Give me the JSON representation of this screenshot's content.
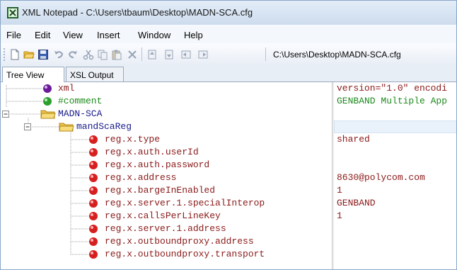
{
  "window": {
    "title": "XML Notepad - C:\\Users\\tbaum\\Desktop\\MADN-SCA.cfg"
  },
  "menu": [
    {
      "label": "File"
    },
    {
      "label": "Edit"
    },
    {
      "label": "View"
    },
    {
      "label": "Insert"
    },
    {
      "label": "Window"
    },
    {
      "label": "Help"
    }
  ],
  "toolbar": {
    "path": "C:\\Users\\Desktop\\MADN-SCA.cfg",
    "buttons": [
      "new-icon",
      "open-icon",
      "save-icon",
      "undo-icon",
      "redo-icon",
      "cut-icon",
      "copy-icon",
      "paste-icon",
      "delete-icon",
      "nudge-up-icon",
      "nudge-down-icon",
      "nudge-left-icon",
      "nudge-right-icon"
    ]
  },
  "tabs": {
    "tree_view": "Tree View",
    "xsl_output": "XSL Output"
  },
  "tree": {
    "xml": {
      "name": "xml",
      "value": "version=\"1.0\" encodi"
    },
    "comment": {
      "name": "#comment",
      "value": "GENBAND Multiple App"
    },
    "root": {
      "name": "MADN-SCA"
    },
    "group": {
      "name": "mandScaReg"
    },
    "attributes": [
      {
        "name": "reg.x.type",
        "value": "shared"
      },
      {
        "name": "reg.x.auth.userId",
        "value": ""
      },
      {
        "name": "reg.x.auth.password",
        "value": ""
      },
      {
        "name": "reg.x.address",
        "value": "8630@polycom.com"
      },
      {
        "name": "reg.x.bargeInEnabled",
        "value": "1"
      },
      {
        "name": "reg.x.server.1.specialInterop",
        "value": "GENBAND"
      },
      {
        "name": "reg.x.callsPerLineKey",
        "value": "1"
      },
      {
        "name": "reg.x.server.1.address",
        "value": ""
      },
      {
        "name": "reg.x.outboundproxy.address",
        "value": ""
      },
      {
        "name": "reg.x.outboundproxy.transport",
        "value": ""
      }
    ]
  },
  "colors": {
    "element_text": "#1a1a8c",
    "attribute_text": "#8b1a1a",
    "pi_text": "#8b1a1a",
    "comment_text": "#1e8a1e",
    "value_text": "#8b1a1a"
  }
}
